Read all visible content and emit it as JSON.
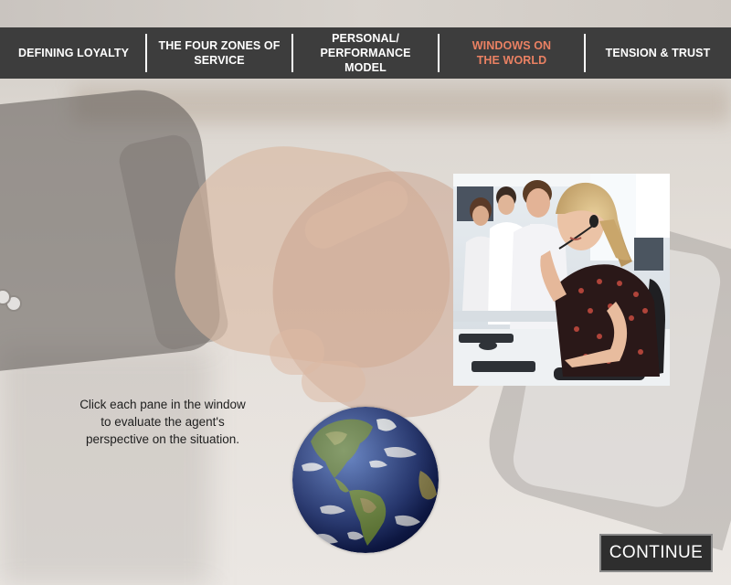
{
  "nav": {
    "items": [
      {
        "label": "DEFINING LOYALTY",
        "active": false
      },
      {
        "label": "THE FOUR ZONES OF\nSERVICE",
        "active": false
      },
      {
        "label": "PERSONAL/\nPERFORMANCE MODEL",
        "active": false
      },
      {
        "label": "WINDOWS ON\nTHE WORLD",
        "active": true
      },
      {
        "label": "TENSION & TRUST",
        "active": false
      }
    ],
    "active_color": "#ea8163",
    "bar_color": "#3d3d3d"
  },
  "instruction": {
    "line1": "Click each pane in the window",
    "line2": "to evaluate the agent's",
    "line3": "perspective on the situation."
  },
  "photo": {
    "icon": "call-center-agents-photo"
  },
  "globe": {
    "icon": "earth-globe-icon"
  },
  "continue_button": {
    "label": "CONTINUE"
  }
}
